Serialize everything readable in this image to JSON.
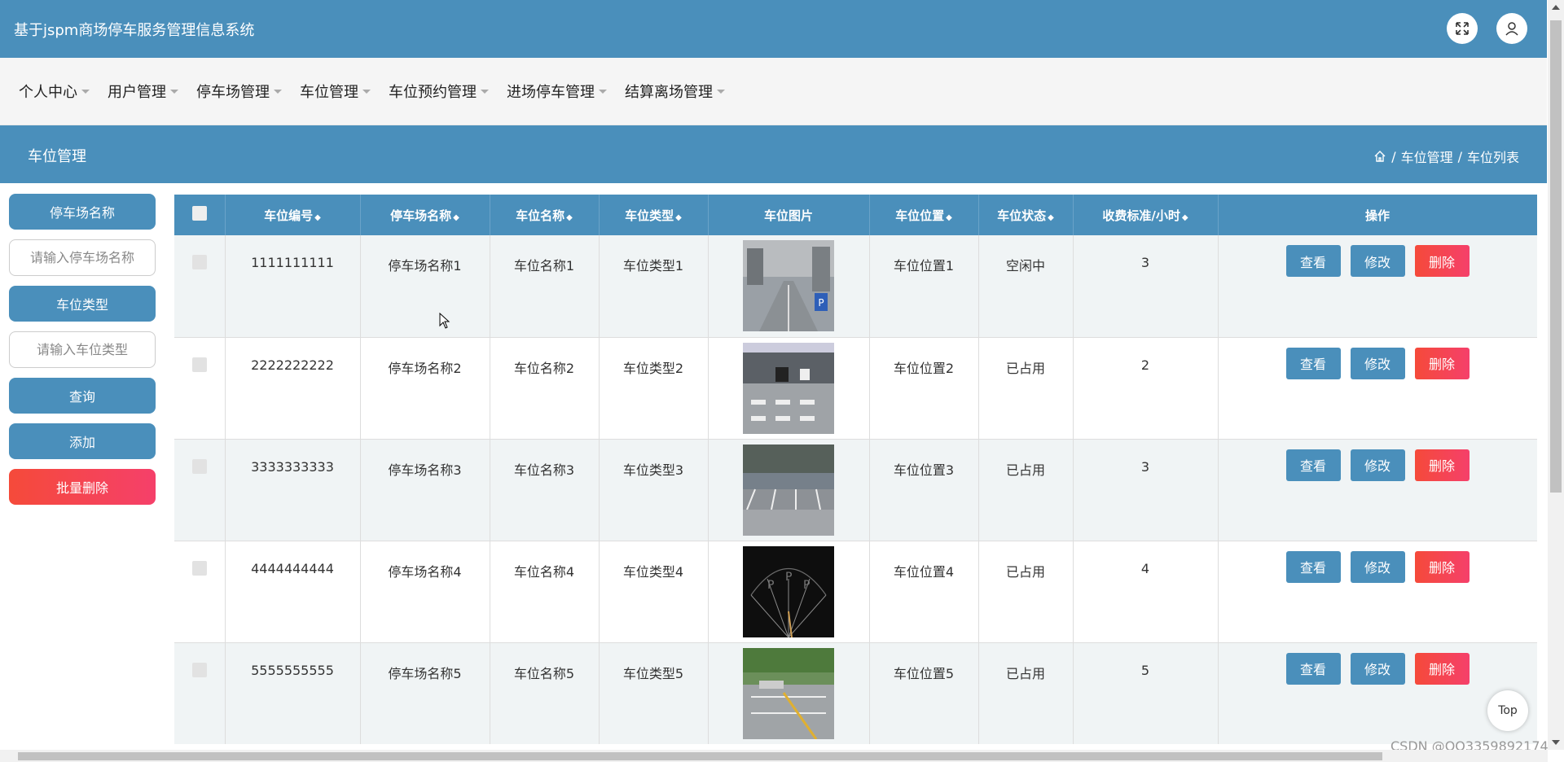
{
  "header": {
    "title": "基于jspm商场停车服务管理信息系统"
  },
  "nav": {
    "items": [
      {
        "label": "个人中心"
      },
      {
        "label": "用户管理"
      },
      {
        "label": "停车场管理"
      },
      {
        "label": "车位管理"
      },
      {
        "label": "车位预约管理"
      },
      {
        "label": "进场停车管理"
      },
      {
        "label": "结算离场管理"
      }
    ]
  },
  "section": {
    "title": "车位管理",
    "breadcrumb": [
      "车位管理",
      "车位列表"
    ],
    "breadcrumb_sep": "/"
  },
  "search": {
    "parking_name_label": "停车场名称",
    "parking_name_placeholder": "请输入停车场名称",
    "spot_type_label": "车位类型",
    "spot_type_placeholder": "请输入车位类型",
    "query_label": "查询",
    "add_label": "添加",
    "batch_delete_label": "批量删除"
  },
  "table": {
    "columns": [
      "车位编号",
      "停车场名称",
      "车位名称",
      "车位类型",
      "车位图片",
      "车位位置",
      "车位状态",
      "收费标准/小时",
      "操作"
    ],
    "sort_glyph": "◆",
    "actions": {
      "view": "查看",
      "edit": "修改",
      "delete": "删除"
    },
    "rows": [
      {
        "id": "1111111111",
        "lot": "停车场名称1",
        "name": "车位名称1",
        "type": "车位类型1",
        "position": "车位位置1",
        "status": "空闲中",
        "rate": "3"
      },
      {
        "id": "2222222222",
        "lot": "停车场名称2",
        "name": "车位名称2",
        "type": "车位类型2",
        "position": "车位位置2",
        "status": "已占用",
        "rate": "2"
      },
      {
        "id": "3333333333",
        "lot": "停车场名称3",
        "name": "车位名称3",
        "type": "车位类型3",
        "position": "车位位置3",
        "status": "已占用",
        "rate": "3"
      },
      {
        "id": "4444444444",
        "lot": "停车场名称4",
        "name": "车位名称4",
        "type": "车位类型4",
        "position": "车位位置4",
        "status": "已占用",
        "rate": "4"
      },
      {
        "id": "5555555555",
        "lot": "停车场名称5",
        "name": "车位名称5",
        "type": "车位类型5",
        "position": "车位位置5",
        "status": "已占用",
        "rate": "5"
      }
    ]
  },
  "top_button": "Top",
  "watermark": "CSDN @QQ3359892174",
  "colors": {
    "primary": "#4a8fbb",
    "danger": "#f54a3a"
  }
}
